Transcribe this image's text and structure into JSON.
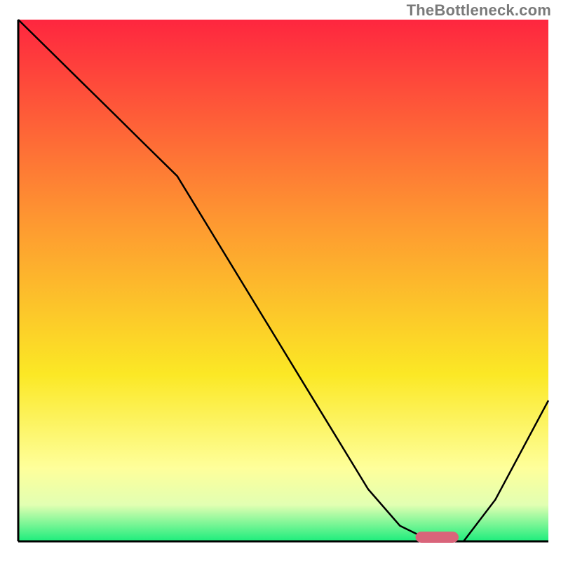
{
  "watermark": "TheBottleneck.com",
  "colors": {
    "gradient_top": "#fe263f",
    "gradient_mid_orange": "#fe9631",
    "gradient_yellow": "#fbe825",
    "gradient_light_yellow": "#feff9b",
    "gradient_pale": "#e2ffb2",
    "gradient_green": "#1ced7c",
    "axis": "#000000",
    "curve": "#000000",
    "marker_fill": "#d9647a",
    "marker_stroke": "#d9647a"
  },
  "chart_data": {
    "type": "line",
    "title": "",
    "xlabel": "",
    "ylabel": "",
    "xlim": [
      0,
      100
    ],
    "ylim": [
      0,
      100
    ],
    "grid": false,
    "legend": false,
    "series": [
      {
        "name": "bottleneck-curve",
        "x": [
          0,
          6,
          12,
          18,
          24,
          30,
          36,
          42,
          48,
          54,
          60,
          66,
          72,
          78,
          84,
          90,
          100
        ],
        "y": [
          100,
          94,
          88,
          82,
          76,
          70,
          60,
          50,
          40,
          30,
          20,
          10,
          3,
          0,
          0,
          8,
          27
        ]
      }
    ],
    "marker": {
      "name": "optimal-point",
      "x_center": 79,
      "y": 0.8,
      "width": 8,
      "height": 2
    },
    "annotations": []
  }
}
